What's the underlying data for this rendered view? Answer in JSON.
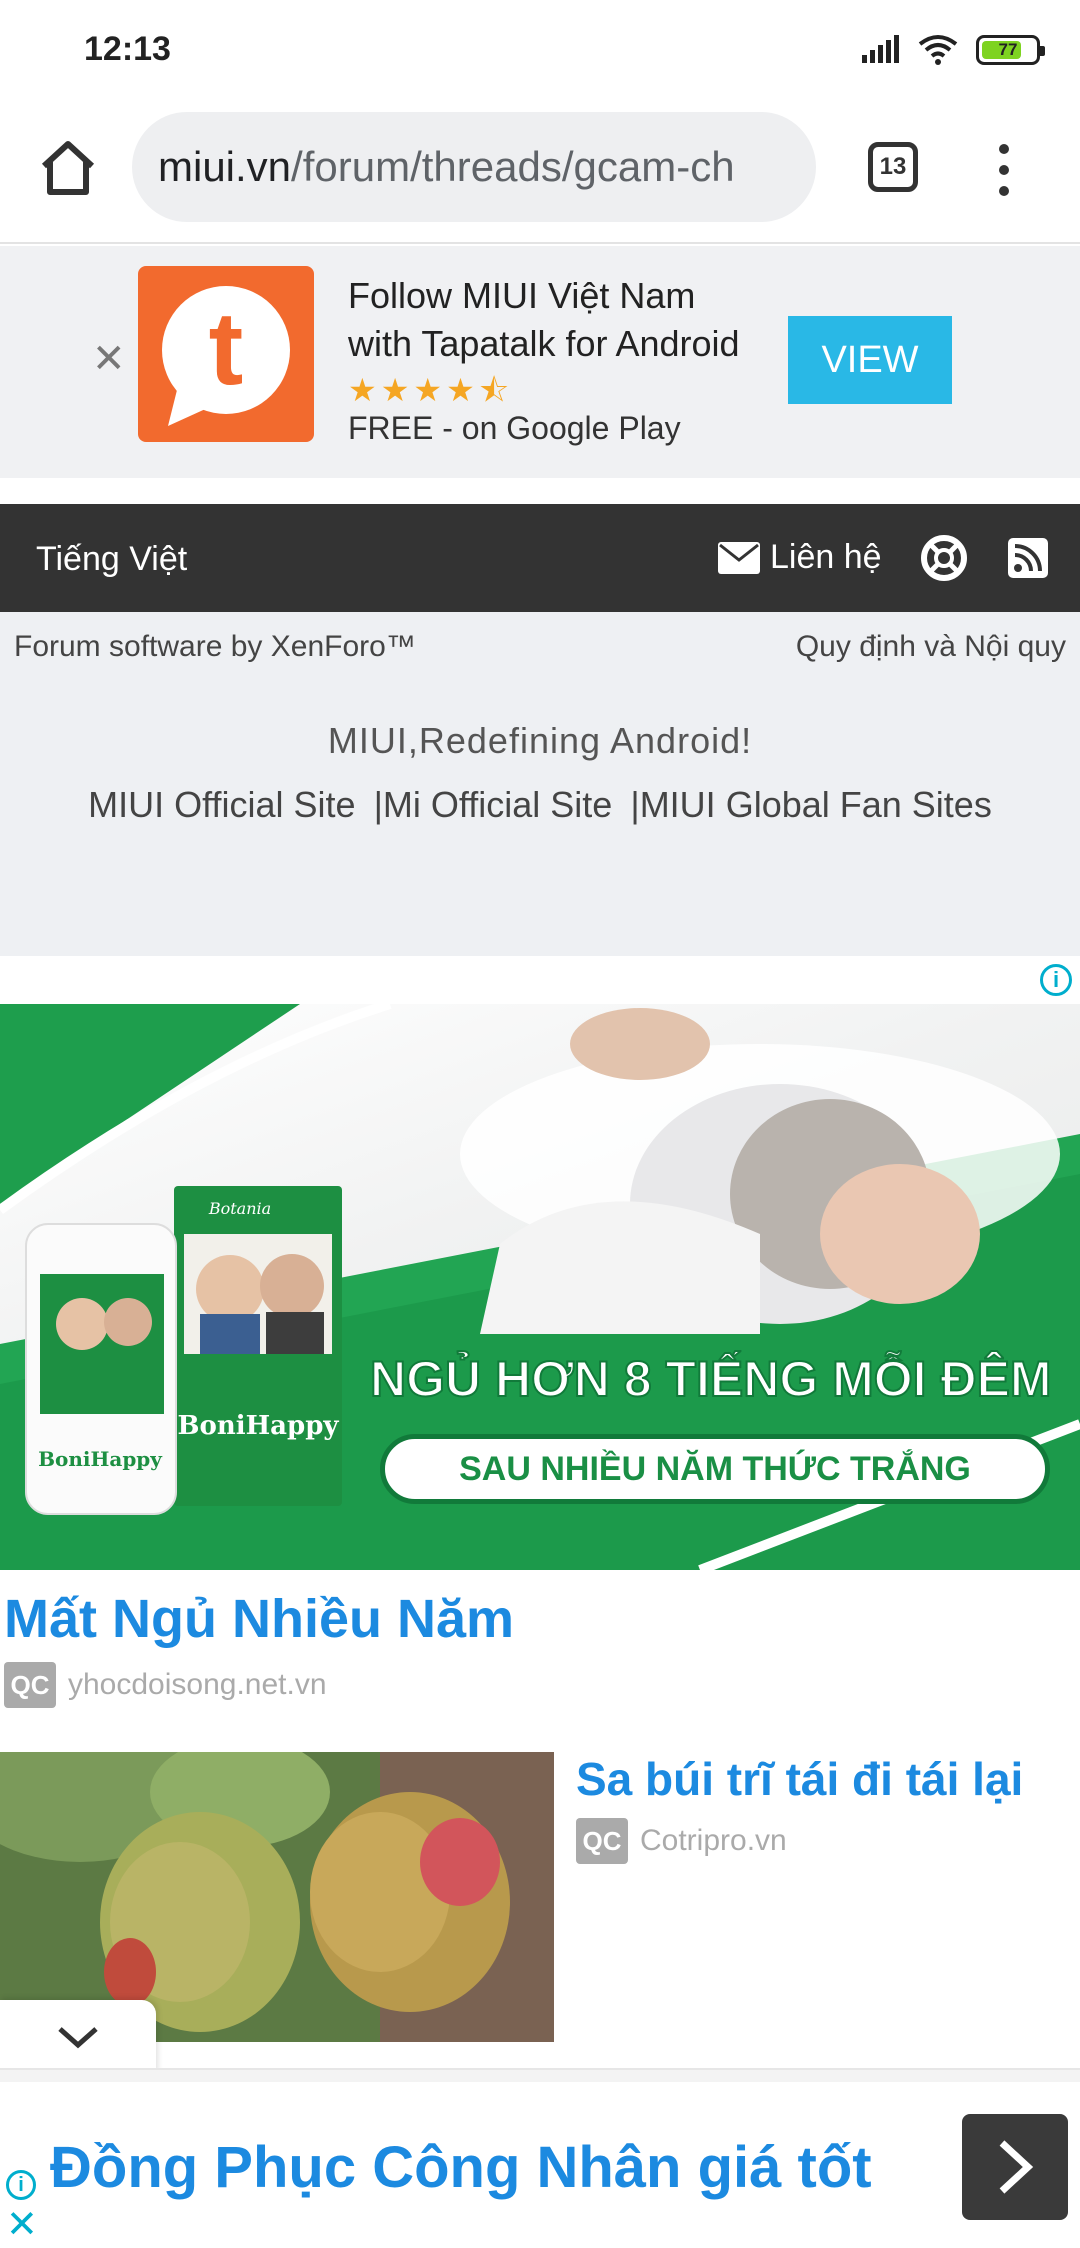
{
  "status_bar": {
    "time": "12:13",
    "battery_level": "77",
    "battery_fraction": 0.77,
    "icons": [
      "signal-icon",
      "wifi-icon",
      "battery-icon"
    ]
  },
  "browser": {
    "url_domain": "miui.vn",
    "url_path": "/forum/threads/gcam-ch",
    "tab_count": "13"
  },
  "tapatalk": {
    "title": "Follow MIUI Việt Nam with Tapatalk for Android",
    "stars": "★★★★⯪",
    "rating": 4.5,
    "subtitle": "FREE - on Google Play",
    "view_label": "VIEW",
    "logo_letter": "t"
  },
  "nav": {
    "language": "Tiếng Việt",
    "contact_label": "Liên hệ"
  },
  "footer": {
    "software": "Forum software by XenForo™",
    "rules": "Quy định và Nội quy",
    "tagline": "MIUI,Redefining Android!",
    "links": [
      "MIUI Official Site",
      "|Mi Official Site",
      "|MIUI Global Fan Sites"
    ]
  },
  "ad_banner": {
    "headline": "NGỦ HƠN 8 TIẾNG MỖI ĐÊM",
    "subline": "SAU NHIỀU NĂM THỨC TRẮNG",
    "product_name": "BoniHappy",
    "brand_name": "Botania"
  },
  "articles": [
    {
      "title": "Mất Ngủ Nhiều Năm",
      "badge": "QC",
      "source": "yhocdoisong.net.vn"
    },
    {
      "title": "Sa búi trĩ tái đi tái lại",
      "badge": "QC",
      "source": "Cotripro.vn"
    }
  ],
  "bottom_ad": {
    "title": "Đồng Phục Công Nhân giá tốt"
  },
  "colors": {
    "link_blue": "#1c8ae0",
    "tapatalk_orange": "#f26a2e",
    "view_button": "#29b8e6",
    "nav_dark": "#333333",
    "ad_green": "#1a8f45"
  }
}
